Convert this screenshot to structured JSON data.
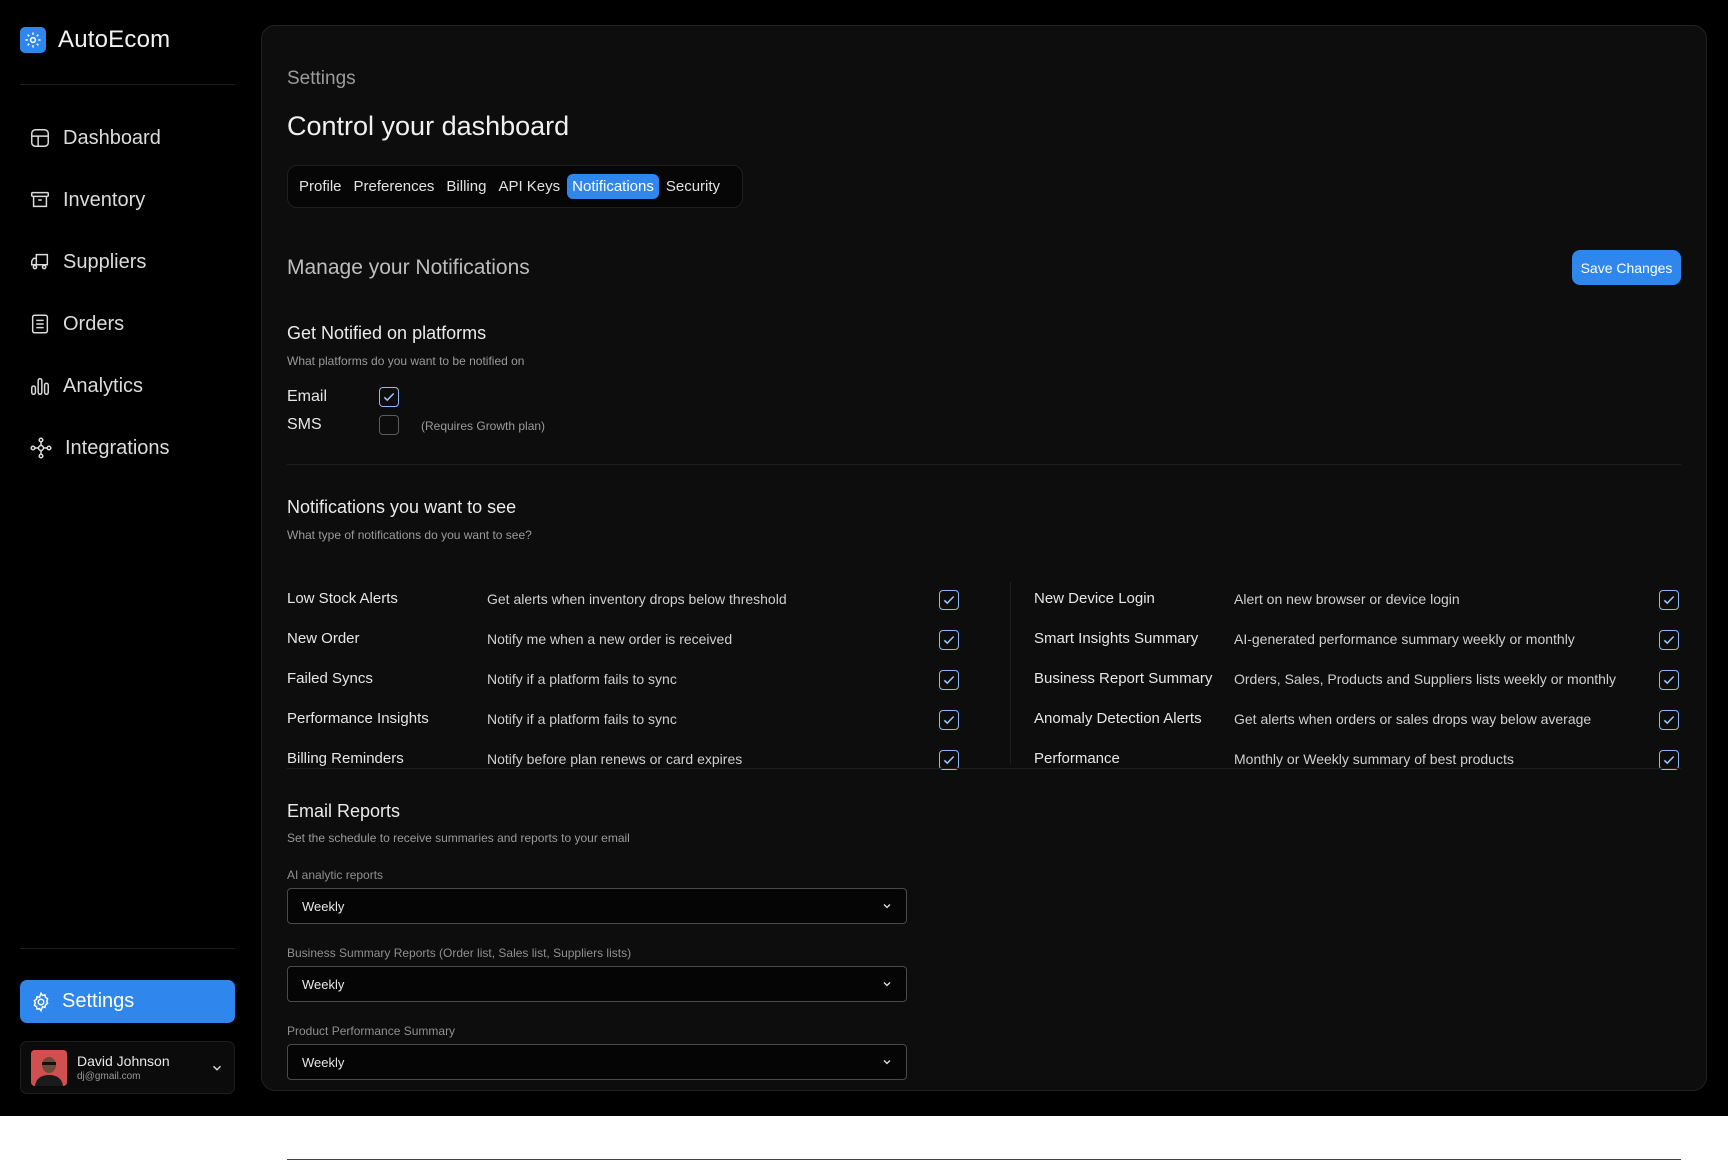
{
  "brand": {
    "name": "AutoEcom",
    "icon": "gear-cog-logo-icon",
    "color": "#2f86ec"
  },
  "nav": {
    "items": [
      {
        "label": "Dashboard",
        "icon": "dashboard-icon"
      },
      {
        "label": "Inventory",
        "icon": "archive-box-icon"
      },
      {
        "label": "Suppliers",
        "icon": "truck-icon"
      },
      {
        "label": "Orders",
        "icon": "document-list-icon"
      },
      {
        "label": "Analytics",
        "icon": "bar-chart-icon"
      },
      {
        "label": "Integrations",
        "icon": "nodes-icon"
      }
    ],
    "settings_label": "Settings",
    "settings_icon": "gear-icon"
  },
  "user": {
    "name": "David Johnson",
    "email": "dj@gmail.com"
  },
  "header": {
    "breadcrumb": "Settings",
    "title": "Control your dashboard"
  },
  "tabs": [
    {
      "label": "Profile",
      "active": false
    },
    {
      "label": "Preferences",
      "active": false
    },
    {
      "label": "Billing",
      "active": false
    },
    {
      "label": "API Keys",
      "active": false
    },
    {
      "label": "Notifications",
      "active": true
    },
    {
      "label": "Security",
      "active": false
    }
  ],
  "manage": {
    "title": "Manage your Notifications",
    "save_label": "Save Changes"
  },
  "platforms": {
    "title": "Get Notified on platforms",
    "description": "What platforms do you want to be notified on",
    "items": [
      {
        "label": "Email",
        "checked": true,
        "note": ""
      },
      {
        "label": "SMS",
        "checked": false,
        "note": "(Requires Growth plan)"
      }
    ]
  },
  "notifications": {
    "title": "Notifications you want to see",
    "description": "What type of notifications do you want to see?",
    "left": [
      {
        "title": "Low Stock Alerts",
        "desc": "Get alerts when inventory drops below threshold",
        "checked": true
      },
      {
        "title": "New Order",
        "desc": "Notify me when a new order is received",
        "checked": true
      },
      {
        "title": "Failed Syncs",
        "desc": "Notify if a platform fails to sync",
        "checked": true
      },
      {
        "title": "Performance Insights",
        "desc": "Notify if a platform fails to sync",
        "checked": true
      },
      {
        "title": "Billing Reminders",
        "desc": "Notify before plan renews or card expires",
        "checked": true
      }
    ],
    "right": [
      {
        "title": "New Device Login",
        "desc": "Alert on new browser or device login",
        "checked": true
      },
      {
        "title": "Smart Insights Summary",
        "desc": "AI-generated performance summary weekly or monthly",
        "checked": true
      },
      {
        "title": "Business Report Summary",
        "desc": "Orders, Sales, Products and Suppliers lists weekly or monthly",
        "checked": true
      },
      {
        "title": "Anomaly Detection Alerts",
        "desc": "Get alerts when orders or sales drops way below average",
        "checked": true
      },
      {
        "title": "Performance",
        "desc": "Monthly or Weekly summary of best products",
        "checked": true
      }
    ]
  },
  "email_reports": {
    "title": "Email Reports",
    "description": "Set the schedule to receive summaries and reports to your email",
    "fields": [
      {
        "label": "AI analytic  reports",
        "value": "Weekly"
      },
      {
        "label": "Business Summary Reports (Order list, Sales list, Suppliers lists)",
        "value": "Weekly"
      },
      {
        "label": "Product Performance Summary",
        "value": "Weekly"
      }
    ]
  }
}
